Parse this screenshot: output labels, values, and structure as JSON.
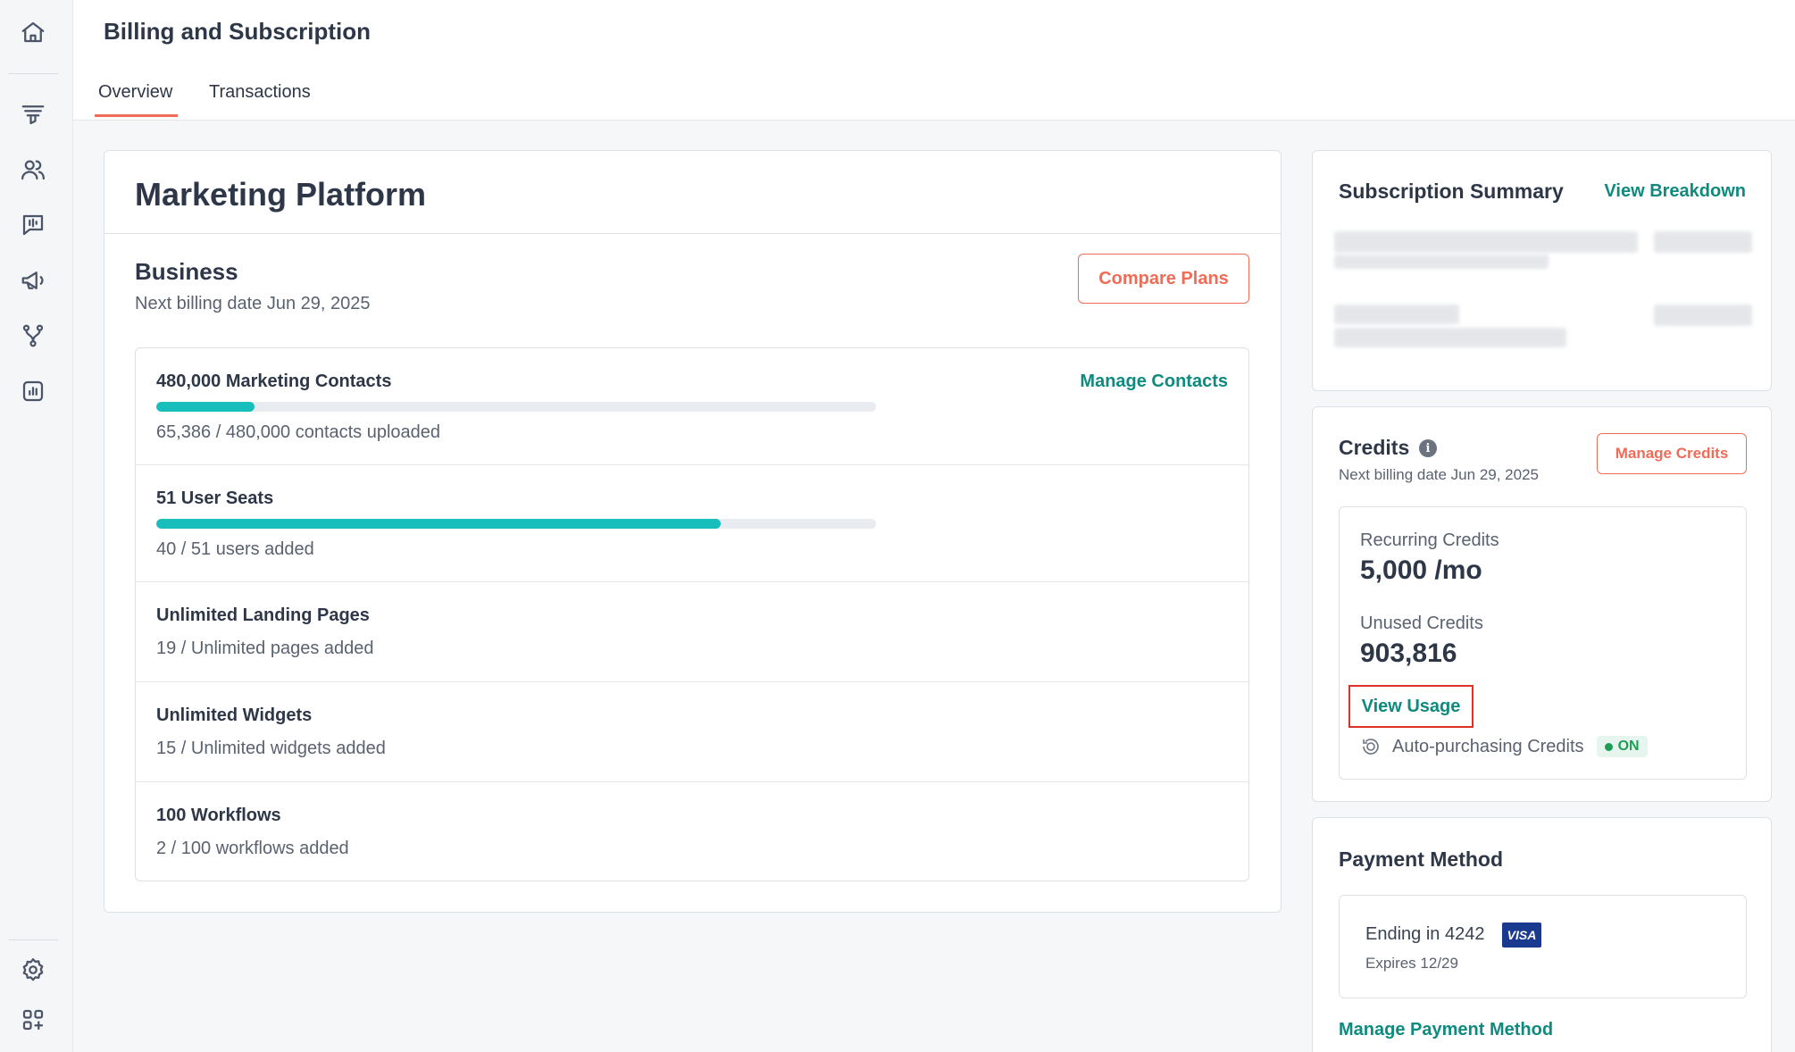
{
  "header": {
    "title": "Billing and Subscription",
    "tabs": [
      {
        "label": "Overview"
      },
      {
        "label": "Transactions"
      }
    ]
  },
  "sidebar": {
    "icons": [
      "home-icon",
      "funnel-icon",
      "contacts-icon",
      "chat-icon",
      "megaphone-icon",
      "workflow-icon",
      "reports-icon",
      "settings-icon",
      "apps-icon"
    ]
  },
  "main": {
    "title": "Marketing Platform",
    "plan": {
      "name": "Business",
      "billing": "Next billing date Jun 29, 2025",
      "compare_label": "Compare Plans"
    },
    "usage": [
      {
        "label": "480,000 Marketing Contacts",
        "sub": "65,386 / 480,000 contacts uploaded",
        "progress": 0.136,
        "link": "Manage Contacts"
      },
      {
        "label": "51 User Seats",
        "sub": "40 / 51 users added",
        "progress": 0.784
      },
      {
        "label": "Unlimited Landing Pages",
        "sub": "19 / Unlimited pages added"
      },
      {
        "label": "Unlimited Widgets",
        "sub": "15 / Unlimited widgets added"
      },
      {
        "label": "100 Workflows",
        "sub": "2 / 100 workflows added"
      }
    ]
  },
  "summary": {
    "title": "Subscription Summary",
    "link": "View Breakdown"
  },
  "credits": {
    "title": "Credits",
    "billing": "Next billing date Jun 29, 2025",
    "manage_label": "Manage Credits",
    "recurring_label": "Recurring Credits",
    "recurring_value": "5,000 /mo",
    "unused_label": "Unused Credits",
    "unused_value": "903,816",
    "view_usage": "View Usage",
    "auto_label": "Auto-purchasing Credits",
    "auto_status": "ON"
  },
  "payment": {
    "title": "Payment Method",
    "ending": "Ending in 4242",
    "brand": "VISA",
    "expires": "Expires 12/29",
    "manage_label": "Manage Payment Method"
  },
  "colors": {
    "accent": "#ef6c57",
    "link": "#0f8a7e",
    "progress": "#17bebb",
    "highlight": "#e0302a"
  }
}
